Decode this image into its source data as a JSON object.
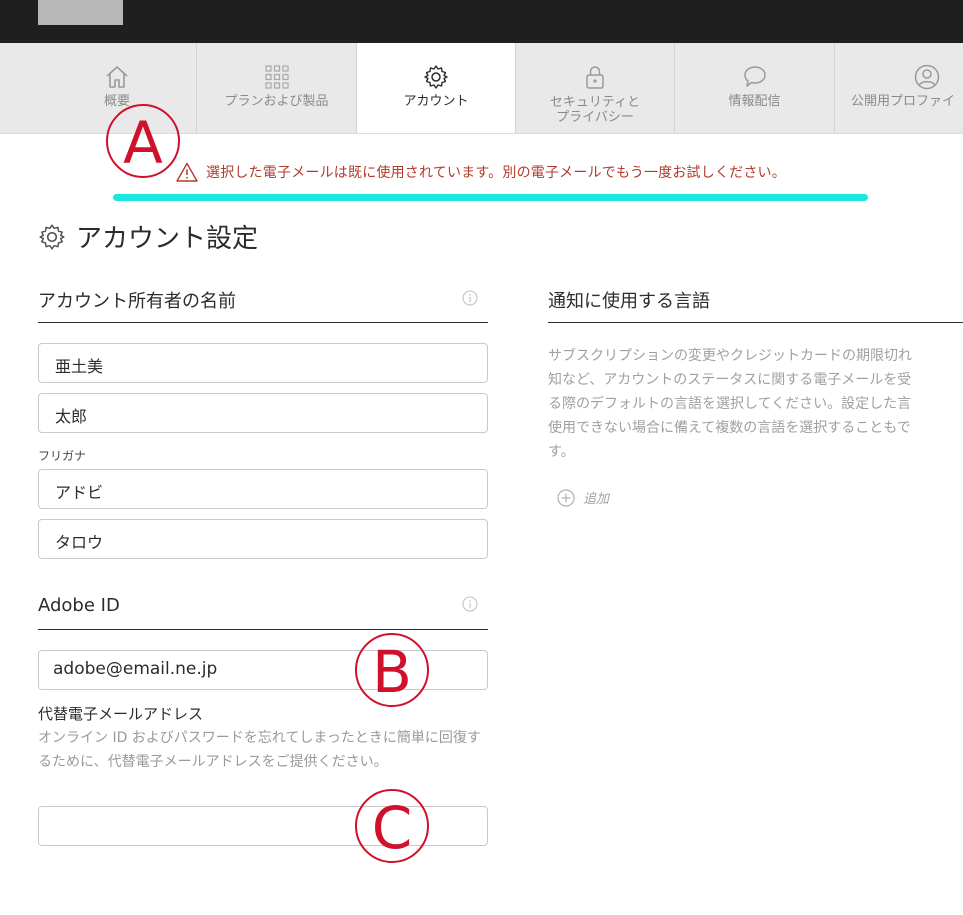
{
  "tabs": [
    {
      "label": "概要",
      "icon": "home-icon"
    },
    {
      "label": "プランおよび製品",
      "icon": "grid-icon"
    },
    {
      "label": "アカウント",
      "icon": "gear-icon",
      "active": true
    },
    {
      "label": "セキュリティと\nプライバシー",
      "icon": "lock-icon"
    },
    {
      "label": "情報配信",
      "icon": "speech-bubble-icon"
    },
    {
      "label": "公開用プロファイ",
      "icon": "user-icon"
    }
  ],
  "annotations": {
    "a": "A",
    "b": "B",
    "c": "C"
  },
  "error": {
    "message": "選択した電子メールは既に使用されています。別の電子メールでもう一度お試しください。"
  },
  "page": {
    "title": "アカウント設定"
  },
  "owner_section": {
    "heading": "アカウント所有者の名前",
    "last_name": "亜土美",
    "first_name": "太郎",
    "furigana_label": "フリガナ",
    "furigana_last": "アドビ",
    "furigana_first": "タロウ"
  },
  "adobe_id_section": {
    "heading": "Adobe ID",
    "email": "adobe@email.ne.jp",
    "alt_email_label": "代替電子メールアドレス",
    "alt_email_help": "オンライン ID およびパスワードを忘れてしまったときに簡単に回復するために、代替電子メールアドレスをご提供ください。",
    "alt_email_value": ""
  },
  "language_section": {
    "heading": "通知に使用する言語",
    "description": "サブスクリプションの変更やクレジットカードの期限切れ\n知など、アカウントのステータスに関する電子メールを受\nる際のデフォルトの言語を選択してください。設定した言\n使用できない場合に備えて複数の言語を選択することもで\nす。",
    "add_label": "追加"
  },
  "colors": {
    "error": "#b23b2d",
    "highlight": "#18e8e0",
    "annotation": "#d0112b",
    "topbar": "#1f1f1f",
    "tabbar": "#e9e9e9"
  }
}
